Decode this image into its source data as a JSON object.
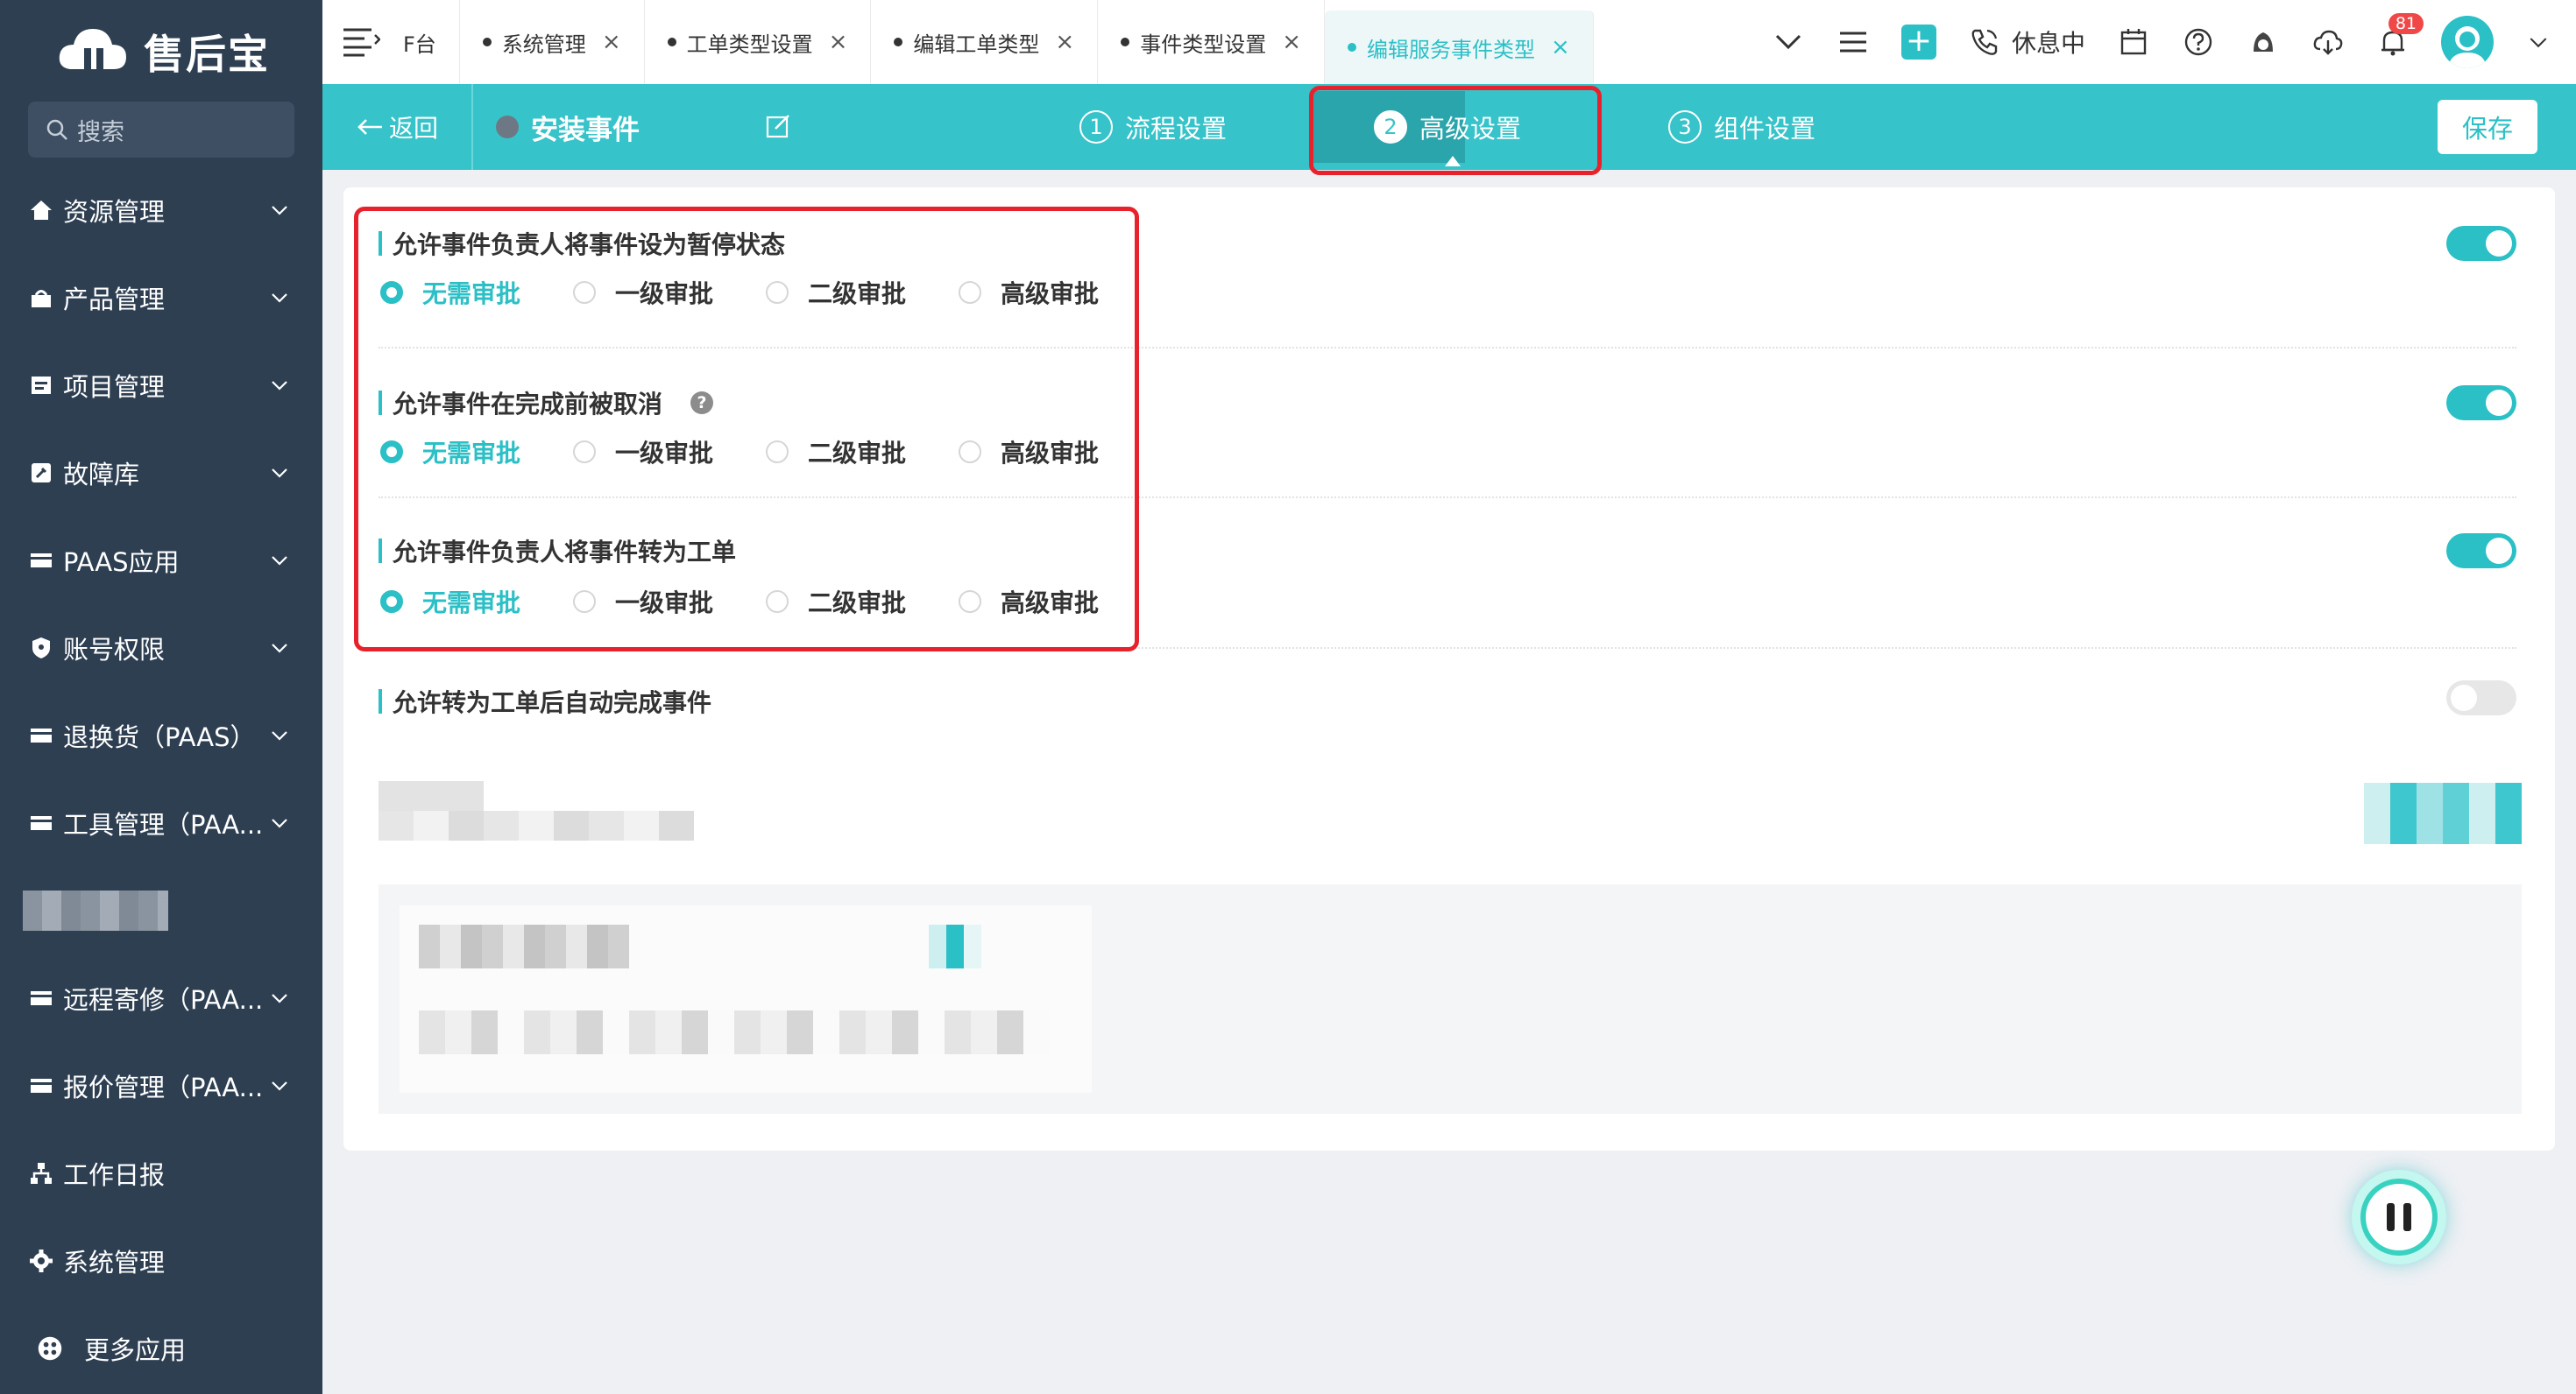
{
  "app": {
    "name": "售后宝"
  },
  "search": {
    "placeholder": "搜索"
  },
  "sidebar": {
    "items": [
      {
        "label": "资源管理",
        "icon": "home-icon"
      },
      {
        "label": "产品管理",
        "icon": "product-icon"
      },
      {
        "label": "项目管理",
        "icon": "project-icon"
      },
      {
        "label": "故障库",
        "icon": "fault-icon"
      },
      {
        "label": "PAAS应用",
        "icon": "card-icon"
      },
      {
        "label": "账号权限",
        "icon": "shield-icon"
      },
      {
        "label": "退换货（PAAS）",
        "icon": "card-icon"
      },
      {
        "label": "工具管理（PAA...",
        "icon": "card-icon"
      },
      {
        "label": "远程寄修（PAA...",
        "icon": "card-icon"
      },
      {
        "label": "报价管理（PAA...",
        "icon": "card-icon"
      },
      {
        "label": "工作日报",
        "icon": "org-icon"
      },
      {
        "label": "系统管理",
        "icon": "gear-icon"
      },
      {
        "label": "更多应用",
        "icon": "apps-icon"
      }
    ]
  },
  "tabs": [
    {
      "label": "F台"
    },
    {
      "label": "系统管理"
    },
    {
      "label": "工单类型设置"
    },
    {
      "label": "编辑工单类型"
    },
    {
      "label": "事件类型设置"
    },
    {
      "label": "编辑服务事件类型"
    }
  ],
  "topbar": {
    "status": "休息中",
    "notifications": "81"
  },
  "subheader": {
    "back_label": "返回",
    "event_name": "安装事件",
    "steps": [
      {
        "num": "1",
        "label": "流程设置"
      },
      {
        "num": "2",
        "label": "高级设置"
      },
      {
        "num": "3",
        "label": "组件设置"
      }
    ],
    "save_label": "保存"
  },
  "settings": [
    {
      "title": "允许事件负责人将事件设为暂停状态",
      "enabled": true,
      "options": [
        "无需审批",
        "一级审批",
        "二级审批",
        "高级审批"
      ],
      "selected": "无需审批"
    },
    {
      "title": "允许事件在完成前被取消",
      "help": "?",
      "enabled": true,
      "options": [
        "无需审批",
        "一级审批",
        "二级审批",
        "高级审批"
      ],
      "selected": "无需审批"
    },
    {
      "title": "允许事件负责人将事件转为工单",
      "enabled": true,
      "options": [
        "无需审批",
        "一级审批",
        "二级审批",
        "高级审批"
      ],
      "selected": "无需审批"
    },
    {
      "title": "允许转为工单后自动完成事件",
      "enabled": false
    }
  ],
  "colors": {
    "accent": "#2bbfc6",
    "sidebar": "#2e3f52",
    "highlight": "#e8222c"
  }
}
